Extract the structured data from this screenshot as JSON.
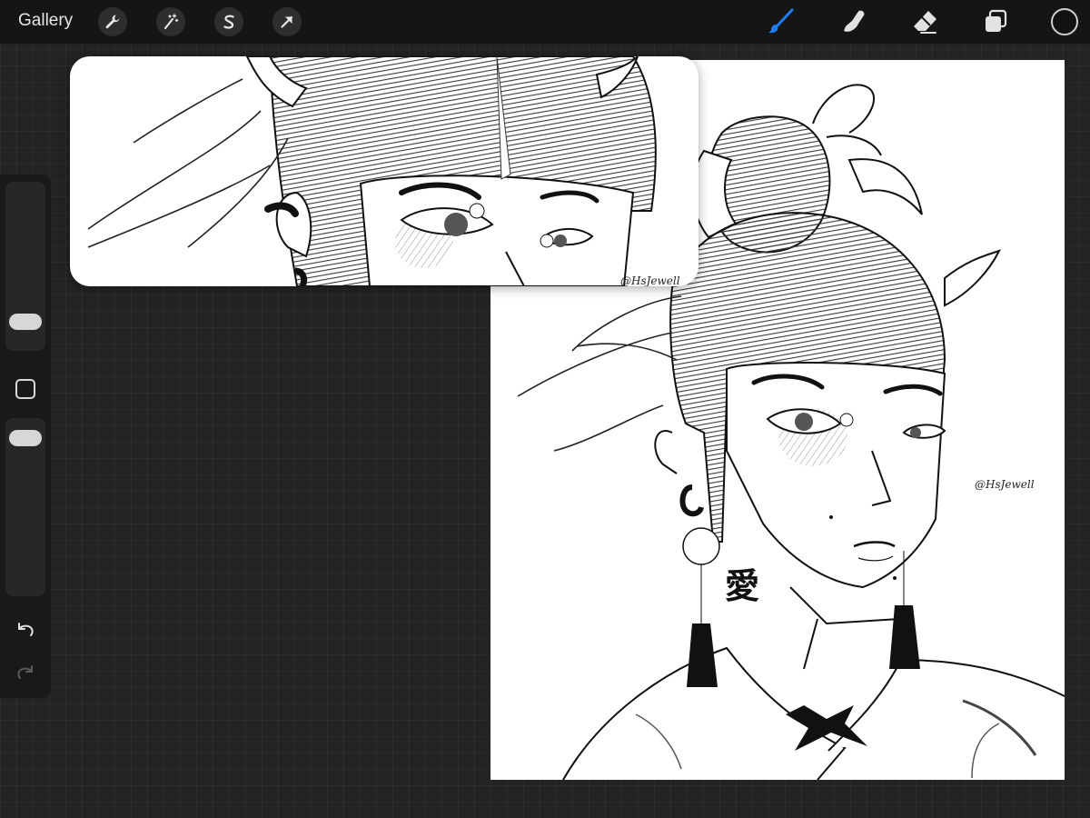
{
  "topbar": {
    "gallery_label": "Gallery",
    "left_tools": [
      {
        "name": "actions",
        "icon": "wrench-icon"
      },
      {
        "name": "adjustments",
        "icon": "magic-wand-icon"
      },
      {
        "name": "selection",
        "icon": "selection-s-icon"
      },
      {
        "name": "transform",
        "icon": "arrow-cursor-icon"
      }
    ],
    "right_tools": [
      {
        "name": "brush",
        "icon": "brush-icon",
        "active": true,
        "color": "#1f7cf5"
      },
      {
        "name": "smudge",
        "icon": "smudge-finger-icon"
      },
      {
        "name": "eraser",
        "icon": "eraser-icon"
      },
      {
        "name": "layers",
        "icon": "layers-icon"
      },
      {
        "name": "color",
        "icon": "color-swatch",
        "color": "#121212"
      }
    ]
  },
  "sidebar": {
    "brush_size_level": 0.2,
    "opacity_level": 0.78,
    "modify_icon": "square-modify-icon",
    "undo_icon": "undo-arrow-icon",
    "redo_icon": "redo-arrow-icon"
  },
  "canvas": {
    "artwork": "ink sketch of a woman with horned hairpiece, hair bun and tassel earrings",
    "signature": "@HsJewell",
    "kanji": "愛"
  },
  "reference_window": {
    "signature": "@HsJewell"
  },
  "colors": {
    "topbar_bg": "#151515",
    "app_bg": "#232323",
    "accent": "#1f7cf5"
  }
}
